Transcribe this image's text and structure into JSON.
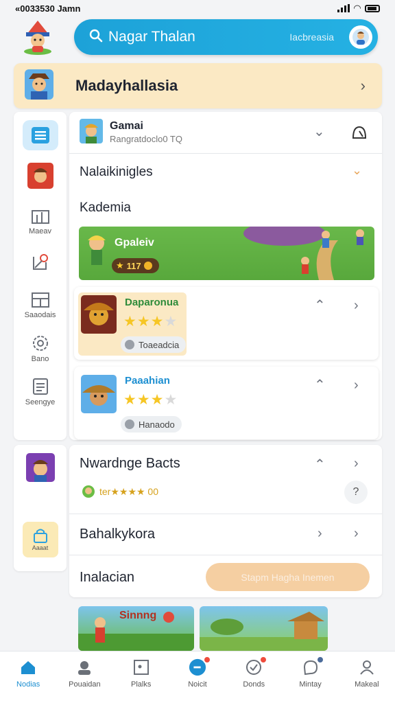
{
  "status_bar": {
    "time": "«0033530 Jamn"
  },
  "search": {
    "query": "Nagar Thalan",
    "hint": "Iacbreasia"
  },
  "banner": {
    "title": "Madayhallasia"
  },
  "sidenav": {
    "items": [
      {
        "label": "",
        "icon": "list-icon"
      },
      {
        "label": "",
        "icon": "character-icon"
      },
      {
        "label": "Maeav",
        "icon": "chart-icon"
      },
      {
        "label": "",
        "icon": "location-icon"
      },
      {
        "label": "Saaodais",
        "icon": "grid-icon"
      },
      {
        "label": "Bano",
        "icon": "settings-icon"
      },
      {
        "label": "Seengye",
        "icon": "document-icon"
      }
    ],
    "lower_items": [
      {
        "label": "",
        "icon": "character-icon"
      },
      {
        "label": "Aaaat",
        "icon": "lock-icon"
      }
    ]
  },
  "panel_top": {
    "game_title": "Gamai",
    "game_subtitle": "Rangratdoclo0 TQ",
    "row1": "Nalaikinigles",
    "row2": "Kademia",
    "map_label": "Gpaleiv",
    "map_score": "117"
  },
  "cards": [
    {
      "title": "Daparonua",
      "rating": 3.5,
      "tag": "Toaeadcia"
    },
    {
      "title": "Paaahian",
      "rating": 3.5,
      "tag": "Hanaodo"
    }
  ],
  "panel_bottom": {
    "row1": "Nwardnge Bacts",
    "row1_meta": "ter★★★★ 00",
    "row2": "Bahalkykora",
    "row3": "Inalacian",
    "cta": "Stapm Hagha Inemen"
  },
  "bottom_thumb": {
    "label": "Sinnng"
  },
  "tabs": [
    {
      "label": "Nodias",
      "icon": "home-icon",
      "active": true
    },
    {
      "label": "Pouaidan",
      "icon": "profile-icon"
    },
    {
      "label": "Plalks",
      "icon": "frame-icon"
    },
    {
      "label": "Noicit",
      "icon": "chat-icon",
      "badge": true
    },
    {
      "label": "Donds",
      "icon": "check-icon",
      "badge": true
    },
    {
      "label": "Mintay",
      "icon": "bubble-icon",
      "badge": true
    },
    {
      "label": "Makeal",
      "icon": "user-icon"
    }
  ],
  "colors": {
    "accent": "#1da2d8",
    "banner": "#fbe9c4",
    "star": "#f6c625",
    "cta": "#f5cfa2"
  }
}
